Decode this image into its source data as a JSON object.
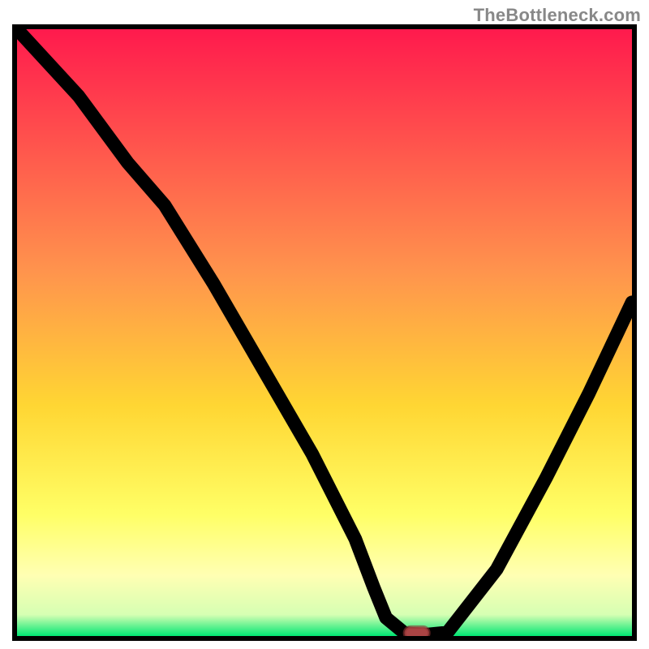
{
  "watermark": {
    "text": "TheBottleneck.com"
  },
  "chart_data": {
    "type": "line",
    "title": "",
    "xlabel": "",
    "ylabel": "",
    "xlim": [
      0,
      100
    ],
    "ylim": [
      0,
      100
    ],
    "grid": false,
    "legend": false,
    "background": {
      "type": "vertical_gradient",
      "stops": [
        {
          "offset": 0.0,
          "color": "#ff1a4d"
        },
        {
          "offset": 0.4,
          "color": "#ff944d"
        },
        {
          "offset": 0.62,
          "color": "#ffd633"
        },
        {
          "offset": 0.8,
          "color": "#ffff66"
        },
        {
          "offset": 0.9,
          "color": "#ffffb3"
        },
        {
          "offset": 0.965,
          "color": "#d6ffb3"
        },
        {
          "offset": 1.0,
          "color": "#00e673"
        }
      ]
    },
    "series": [
      {
        "name": "bottleneck-curve",
        "x": [
          0,
          10,
          18,
          24,
          32,
          40,
          48,
          55,
          58,
          60,
          63,
          66,
          70,
          78,
          86,
          93,
          100
        ],
        "y": [
          100,
          89,
          78,
          71,
          58,
          44,
          30,
          16,
          8,
          3,
          0.5,
          0.2,
          0.6,
          11,
          26,
          40,
          55
        ]
      }
    ],
    "marker": {
      "x": 65,
      "y": 0.5,
      "shape": "rounded-rect",
      "color": "#c85050"
    }
  }
}
